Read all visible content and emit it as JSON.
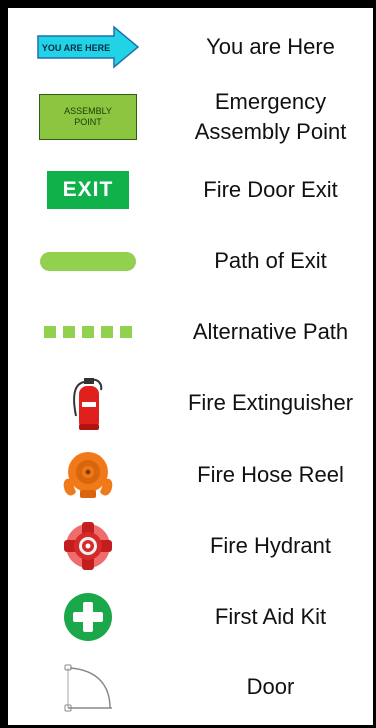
{
  "legend": {
    "items": [
      {
        "symbol": "you-are-here-arrow",
        "label": "You are Here",
        "symbol_text": "YOU ARE HERE"
      },
      {
        "symbol": "assembly-point-sign",
        "label_lines": [
          "Emergency",
          "Assembly Point"
        ],
        "symbol_text_lines": [
          "ASSEMBLY",
          "POINT"
        ]
      },
      {
        "symbol": "exit-sign",
        "label": "Fire Door Exit",
        "symbol_text": "EXIT"
      },
      {
        "symbol": "solid-path-bar",
        "label": "Path of Exit"
      },
      {
        "symbol": "dashed-path-bar",
        "label": "Alternative Path"
      },
      {
        "symbol": "fire-extinguisher-icon",
        "label": "Fire Extinguisher"
      },
      {
        "symbol": "fire-hose-reel-icon",
        "label": "Fire Hose Reel"
      },
      {
        "symbol": "fire-hydrant-icon",
        "label": "Fire Hydrant"
      },
      {
        "symbol": "first-aid-icon",
        "label": "First Aid Kit"
      },
      {
        "symbol": "door-swing-icon",
        "label": "Door"
      }
    ]
  },
  "colors": {
    "arrow_fill": "#22d3e6",
    "arrow_stroke": "#1f6fb0",
    "assembly_fill": "#8cc640",
    "exit_fill": "#10b14b",
    "path_fill": "#92d050",
    "extinguisher": "#e0201b",
    "hose_reel": "#f07a1a",
    "hydrant": "#d42a2a",
    "first_aid": "#1aa84a"
  }
}
